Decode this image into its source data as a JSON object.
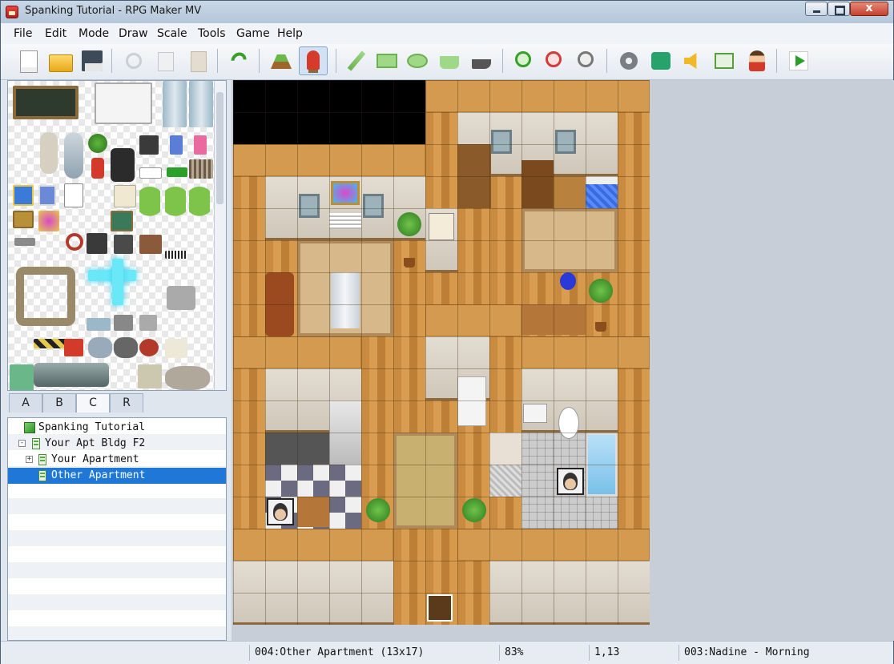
{
  "window": {
    "title": "Spanking Tutorial - RPG Maker MV",
    "close_glyph": "x"
  },
  "menubar": {
    "items": [
      "File",
      "Edit",
      "Mode",
      "Draw",
      "Scale",
      "Tools",
      "Game",
      "Help"
    ]
  },
  "toolbar": {
    "tools": [
      "new-project",
      "open-project",
      "save-project",
      "cut",
      "copy",
      "paste",
      "undo",
      "map-mode",
      "event-mode",
      "pencil",
      "rectangle",
      "ellipse",
      "flood-fill",
      "shadow-pen",
      "zoom-in",
      "zoom-out",
      "actual-size",
      "database",
      "plugin-manager",
      "sound-test",
      "event-searcher",
      "character-generator",
      "playtest"
    ],
    "selected": "event-mode"
  },
  "palette": {
    "tabs": [
      "A",
      "B",
      "C",
      "R"
    ],
    "active_tab": "C"
  },
  "map_tree": {
    "items": [
      {
        "label": "Spanking Tutorial",
        "level": 0,
        "icon": "project-cube-icon"
      },
      {
        "label": "Your Apt Bldg F2",
        "level": 1,
        "toggle": "-"
      },
      {
        "label": "Your Apartment",
        "level": 2,
        "toggle": "+"
      },
      {
        "label": "Other Apartment",
        "level": 2,
        "selected": true
      }
    ]
  },
  "statusbar": {
    "map_info": "004:Other Apartment (13x17)",
    "zoom": "83%",
    "coords": "1,13",
    "event": "003:Nadine - Morning"
  },
  "colors": {
    "selection": "#1f77d8",
    "floor": "#d99d51",
    "titlebar": "#c9d7e6"
  }
}
